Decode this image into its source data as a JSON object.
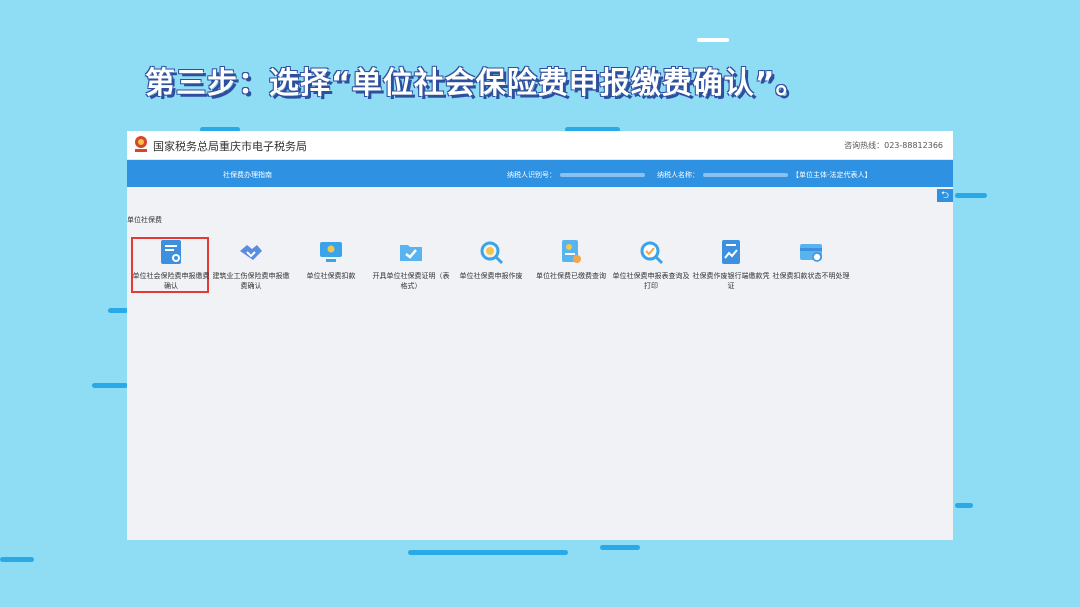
{
  "caption": "第三步：选择“单位社会保险费申报缴费确认”。",
  "header": {
    "site_title": "国家税务总局重庆市电子税务局",
    "hotline": "咨询热线：023-88812366"
  },
  "nav": {
    "guide": "社保费办理指南",
    "taxpayer_id_label": "纳税人识别号：",
    "taxpayer_name_label": "纳税人名称：",
    "role": "【单位主体-法定代表人】"
  },
  "back_glyph": "⮌",
  "section_label": "单位社保费",
  "apps": [
    {
      "label": "单位社会保险费申报缴费确认",
      "icon": "document-confirm-icon",
      "selected": true
    },
    {
      "label": "建筑业工伤保险费申报缴费确认",
      "icon": "handshake-icon"
    },
    {
      "label": "单位社保费扣款",
      "icon": "monitor-icon"
    },
    {
      "label": "开具单位社保费证明（表格式）",
      "icon": "folder-check-icon"
    },
    {
      "label": "单位社保费申报作废",
      "icon": "search-icon"
    },
    {
      "label": "单位社保费已缴费查询",
      "icon": "document-query-icon"
    },
    {
      "label": "单位社保费申报表查询及打印",
      "icon": "magnifier-check-icon"
    },
    {
      "label": "社保费作废银行端缴款凭证",
      "icon": "document-chart-icon"
    },
    {
      "label": "社保费扣款状态不明处理",
      "icon": "card-icon"
    }
  ],
  "colors": {
    "background": "#8fdcf5",
    "nav_blue": "#2f91e2",
    "highlight_red": "#e53935",
    "caption_outline": "#2d4f9e"
  }
}
